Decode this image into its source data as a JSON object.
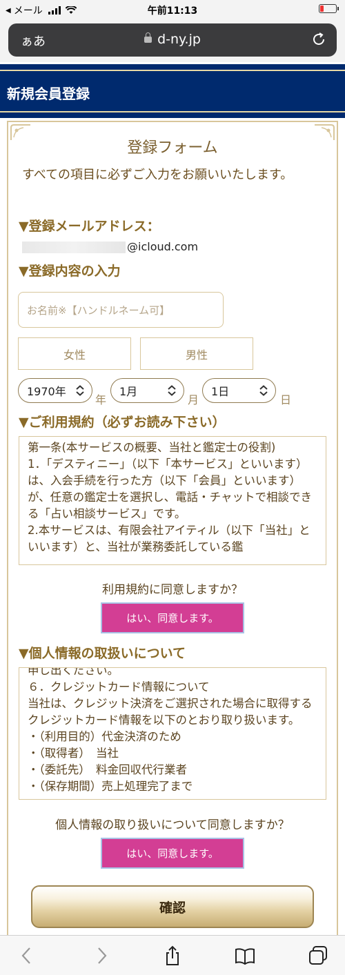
{
  "statusbar": {
    "back_app": "メール",
    "time": "午前11:13"
  },
  "browser": {
    "aa_label": "ぁあ",
    "url": "d-ny.jp"
  },
  "header": {
    "title": "新規会員登録"
  },
  "form": {
    "title": "登録フォーム",
    "intro": "すべての項目に必ずご入力をお願いいたします。",
    "email_section": "▼登録メールアドレス：",
    "email_suffix": "@icloud.com",
    "input_section": "▼登録内容の入力",
    "name_placeholder": "お名前※【ハンドルネーム可】",
    "gender_female": "女性",
    "gender_male": "男性",
    "year_value": "1970年",
    "year_unit": "年",
    "month_value": "1月",
    "month_unit": "月",
    "day_value": "1日",
    "day_unit": "日",
    "terms_section": "▼ご利用規約（必ずお読み下さい）",
    "terms_text": [
      "第一条(本サービスの概要、当社と鑑定士の役割)",
      "1．「デスティニー」（以下「本サービス」といいます）は、入会手続を行った方（以下「会員」といいます）が、任意の鑑定士を選択し、電話・チャットで相談できる「占い相談サービス」です。",
      "2.本サービスは、有限会社アイティル（以下「当社」といいます）と、当社が業務委託している鑑"
    ],
    "terms_question": "利用規約に同意しますか？",
    "terms_agree": "はい、同意します。",
    "privacy_section": "▼個人情報の取扱いについて",
    "privacy_text": [
      "申し出ください。",
      "６．クレジットカード情報について",
      "当社は、クレジット決済をご選択された場合に取得するクレジットカード情報を以下のとおり取り扱います。",
      "・（利用目的）代金決済のため",
      "・（取得者）　当社",
      "・（委託先）　料金回収代行業者",
      "・（保存期間）売上処理完了まで"
    ],
    "privacy_question": "個人情報の取り扱いについて同意しますか？",
    "privacy_agree": "はい、同意します。",
    "confirm": "確認"
  }
}
